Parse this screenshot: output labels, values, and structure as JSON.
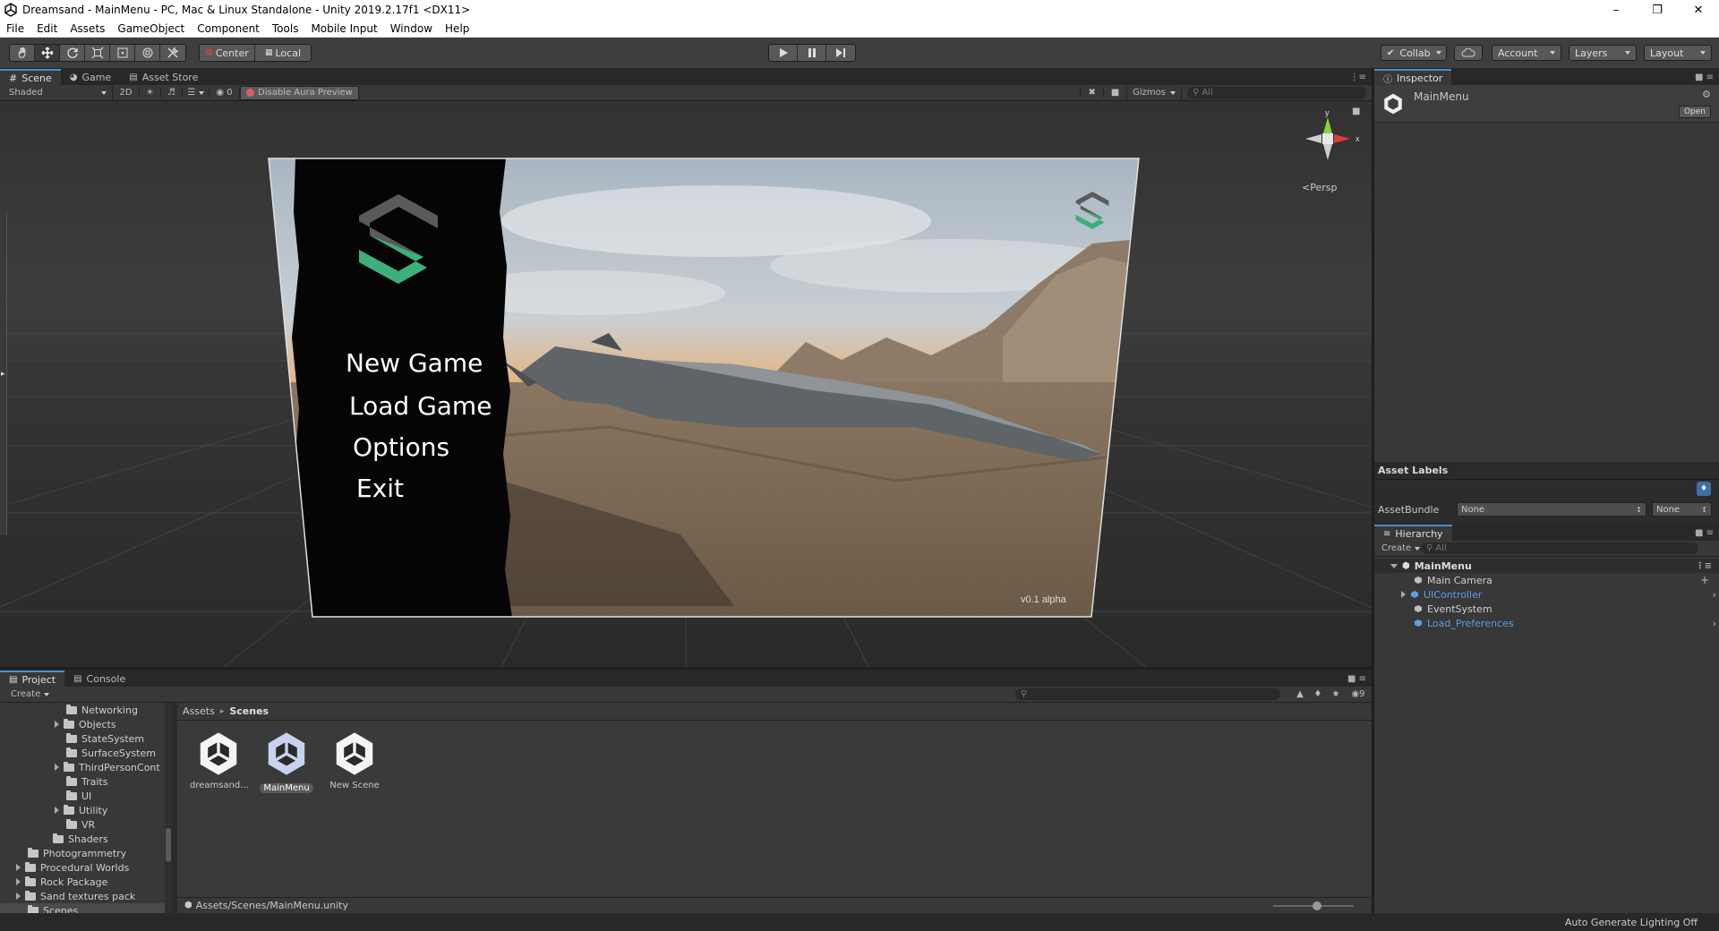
{
  "window": {
    "title": "Dreamsand - MainMenu - PC, Mac & Linux Standalone - Unity 2019.2.17f1 <DX11>",
    "minimize": "–",
    "maximize": "❐",
    "close": "✕"
  },
  "menubar": [
    "File",
    "Edit",
    "Assets",
    "GameObject",
    "Component",
    "Tools",
    "Mobile Input",
    "Window",
    "Help"
  ],
  "toolbar": {
    "pivot": "Center",
    "space": "Local",
    "collab": "Collab",
    "account": "Account",
    "layers": "Layers",
    "layout": "Layout"
  },
  "scene_tabs": {
    "tabs": [
      "Scene",
      "Game",
      "Asset Store"
    ],
    "shading": "Shaded",
    "mode_2d": "2D",
    "hidden_count": "0",
    "aura": "Disable Aura Preview",
    "gizmos": "Gizmos",
    "search_placeholder": "All"
  },
  "scene": {
    "gizmo_label": "Persp",
    "gizmo_y": "y",
    "gizmo_x": "x",
    "menu_items": [
      "New Game",
      "Load Game",
      "Options",
      "Exit"
    ],
    "version": "v0.1 alpha"
  },
  "inspector": {
    "tab": "Inspector",
    "object_name": "MainMenu",
    "open_button": "Open"
  },
  "asset_labels": {
    "title": "Asset Labels",
    "bundle_label": "AssetBundle",
    "bundle_value": "None",
    "variant_value": "None"
  },
  "hierarchy": {
    "tab": "Hierarchy",
    "create": "Create",
    "search_placeholder": "All",
    "scene": "MainMenu",
    "items": [
      {
        "label": "Main Camera",
        "color": "#d0d0d0"
      },
      {
        "label": "UIController",
        "color": "#5c9ee6"
      },
      {
        "label": "EventSystem",
        "color": "#d0d0d0"
      },
      {
        "label": "Load_Preferences",
        "color": "#5c9ee6"
      }
    ]
  },
  "project": {
    "tabs": [
      "Project",
      "Console"
    ],
    "create": "Create",
    "hidden_count": "9",
    "tree": [
      "Networking",
      "Objects",
      "StateSystem",
      "SurfaceSystem",
      "ThirdPersonCont",
      "Traits",
      "UI",
      "Utility",
      "VR",
      "Shaders",
      "Photogrammetry",
      "Procedural Worlds",
      "Rock Package",
      "Sand textures pack",
      "Scenes"
    ],
    "breadcrumb": [
      "Assets",
      "Scenes"
    ],
    "assets": [
      "dreamsand...",
      "MainMenu",
      "New Scene"
    ],
    "footer_path": "Assets/Scenes/MainMenu.unity"
  },
  "status": {
    "lighting": "Auto Generate Lighting Off"
  },
  "colors": {
    "accent_green": "#3bb07a",
    "selection_blue": "#3d6ea8",
    "prefab_blue": "#5c9ee6"
  }
}
